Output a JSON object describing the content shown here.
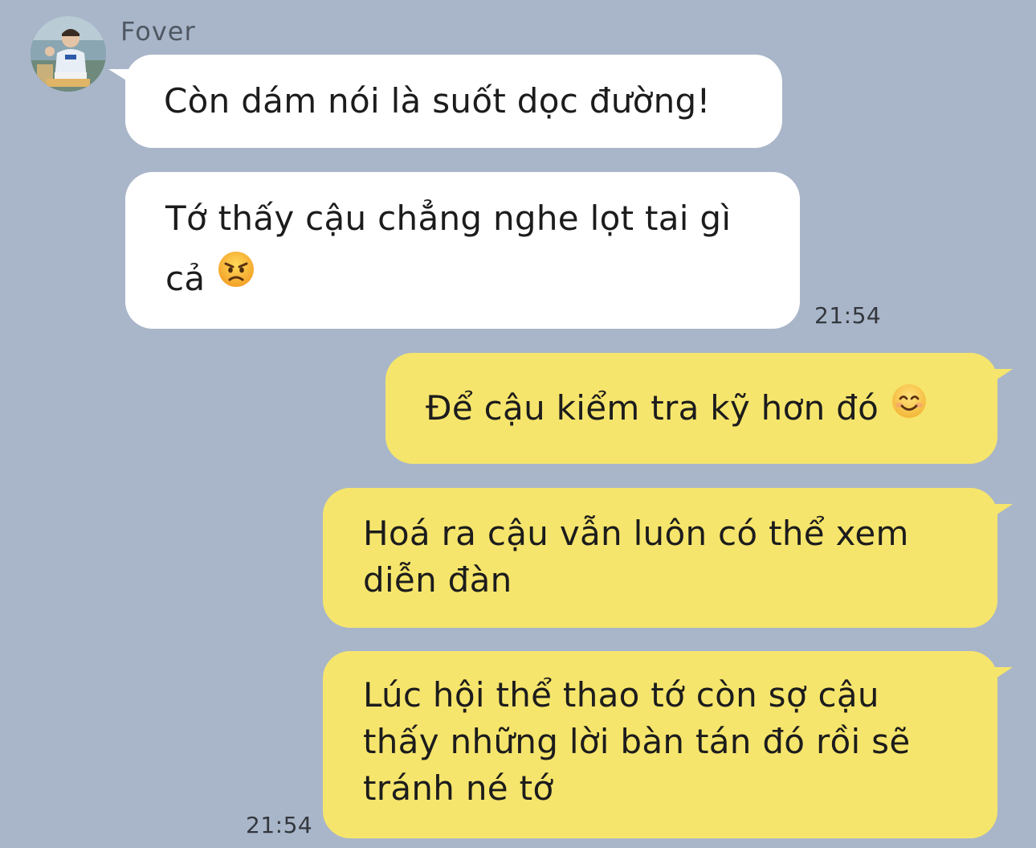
{
  "chat": {
    "sender_name": "Fover",
    "avatar_icon": "profile-photo",
    "incoming_bubble_color": "#ffffff",
    "outgoing_bubble_color": "#f6e56c",
    "background_color": "#a9b6c9"
  },
  "messages": [
    {
      "direction": "incoming",
      "text": "Còn dám nói là suốt dọc đường!"
    },
    {
      "direction": "incoming",
      "text": "Tớ thấy cậu chẳng nghe lọt tai gì cả",
      "emoji": "angry-face-icon",
      "time": "21:54"
    },
    {
      "direction": "outgoing",
      "text": "Để cậu kiểm tra kỹ hơn đó",
      "emoji": "smiling-face-icon"
    },
    {
      "direction": "outgoing",
      "text": "Hoá ra cậu vẫn luôn có thể xem diễn đàn"
    },
    {
      "direction": "outgoing",
      "text": "Lúc hội thể thao tớ còn sợ cậu thấy những lời bàn tán đó rồi sẽ tránh né tớ",
      "time": "21:54"
    }
  ]
}
